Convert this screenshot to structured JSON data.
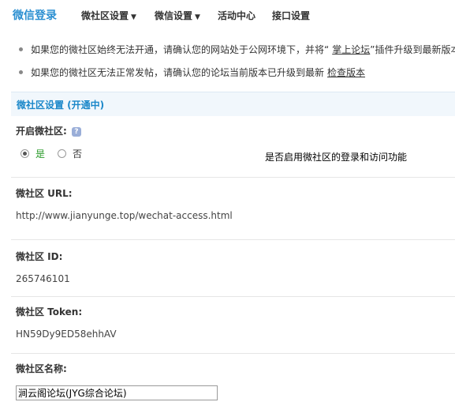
{
  "nav": {
    "title": "微信登录",
    "items": [
      {
        "label": "微社区设置",
        "caret": "▼"
      },
      {
        "label": "微信设置",
        "caret": "▼"
      },
      {
        "label": "活动中心"
      },
      {
        "label": "接口设置"
      }
    ]
  },
  "tips": [
    {
      "text": "如果您的微社区始终无法开通，请确认您的网站处于公网环境下，并将“",
      "link": "掌上论坛",
      "after": "”插件升级到最新版本"
    },
    {
      "text": "如果您的微社区无法正常发帖，请确认您的论坛当前版本已升级到最新",
      "link": "检查版本",
      "after": ""
    }
  ],
  "section": {
    "title": "微社区设置 (开通中)"
  },
  "enable": {
    "label": "开启微社区:",
    "options": [
      {
        "label": "是",
        "selected": true
      },
      {
        "label": "否",
        "selected": false
      }
    ],
    "description": "是否启用微社区的登录和访问功能"
  },
  "url": {
    "label": "微社区 URL:",
    "value": "http://www.jianyunge.top/wechat-access.html"
  },
  "id": {
    "label": "微社区 ID:",
    "value": "265746101"
  },
  "token": {
    "label": "微社区 Token:",
    "value": "HN59Dy9ED58ehhAV"
  },
  "name": {
    "label": "微社区名称:",
    "value": "涧云阁论坛(JYG综合论坛)"
  },
  "colors": {
    "accent": "#1a87c9",
    "section_bg": "#f1f7fc",
    "selected_option": "#2a9a2a"
  }
}
